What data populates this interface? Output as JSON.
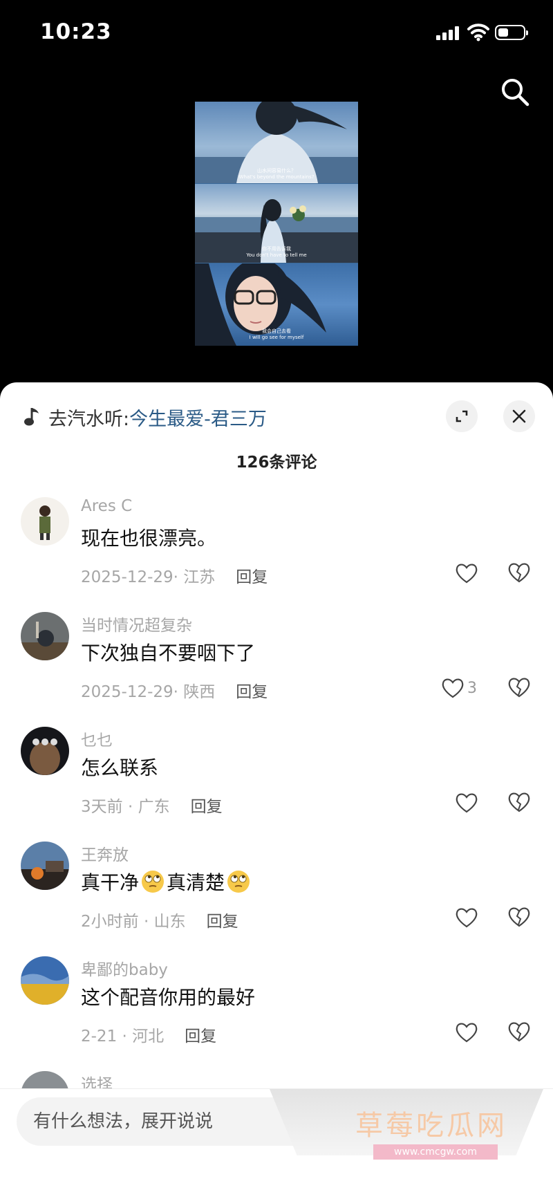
{
  "status_bar": {
    "time": "10:23"
  },
  "video_subtitles": [
    {
      "zh": "山水间容易什么？",
      "en": "What's beyond the mountains?"
    },
    {
      "zh": "你不用告诉我",
      "en": "You don't have to tell me"
    },
    {
      "zh": "我会自己去看",
      "en": "I will go see for myself"
    }
  ],
  "music": {
    "prefix": "去汽水听:",
    "title": "今生最爱-君三万"
  },
  "comments_header": {
    "count_label": "126条评论"
  },
  "comments": [
    {
      "username": "Ares C",
      "text": "现在也很漂亮。",
      "date": "2025-12-29",
      "location": "江苏",
      "reply_label": "回复",
      "likes": ""
    },
    {
      "username": "当时情况超复杂",
      "text": "下次独自不要咽下了",
      "date": "2025-12-29",
      "location": "陕西",
      "reply_label": "回复",
      "likes": "3"
    },
    {
      "username": "乜乜",
      "text": "怎么联系",
      "date": "3天前",
      "location": "广东",
      "reply_label": "回复",
      "likes": ""
    },
    {
      "username": "王奔放",
      "text_part1": "真干净",
      "text_part2": "真清楚",
      "date": "2小时前",
      "location": "山东",
      "reply_label": "回复",
      "likes": ""
    },
    {
      "username": "卑鄙的baby",
      "text": "这个配音你用的最好",
      "date": "2-21",
      "location": "河北",
      "reply_label": "回复",
      "likes": ""
    },
    {
      "username": "选择"
    }
  ],
  "input": {
    "placeholder": "有什么想法，展开说说"
  },
  "watermark": {
    "text": "草莓吃瓜网",
    "url": "www.cmcgw.com"
  },
  "icons": {
    "search": "search-icon",
    "music": "music-note-icon",
    "expand": "expand-icon",
    "close": "close-icon",
    "like": "heart-icon",
    "dislike": "broken-heart-icon",
    "emoji": "eye-roll-emoji-icon"
  },
  "colors": {
    "music_title": "#2a5a86",
    "meta": "#a6a6a6",
    "sheet": "#ffffff"
  }
}
